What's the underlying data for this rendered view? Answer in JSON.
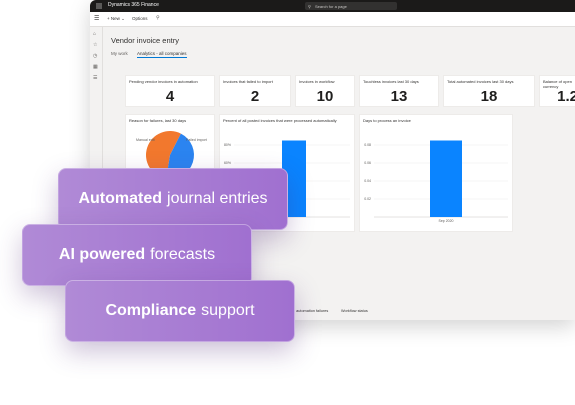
{
  "topbar": {
    "app_name": "Dynamics 365 Finance",
    "search_placeholder": "Search for a page"
  },
  "commands": {
    "new_label": "New",
    "options_label": "Options"
  },
  "page": {
    "title": "Vendor invoice entry",
    "tabs": [
      "My work",
      "Analytics - all companies"
    ]
  },
  "tiles": [
    {
      "label": "Pending vendor invoices in automation",
      "value": "4"
    },
    {
      "label": "Invoices that failed to import",
      "value": "2"
    },
    {
      "label": "Invoices in workflow",
      "value": "10"
    },
    {
      "label": "Touchless invoices last 30 days",
      "value": "13"
    },
    {
      "label": "Total automated invoices last 30 days",
      "value": "18"
    },
    {
      "label": "Balance of open currency",
      "value": "1.2"
    }
  ],
  "panels": [
    {
      "title": "Reason for failures, last 30 days"
    },
    {
      "title": "Percent of all posted invoices that were processed automatically"
    },
    {
      "title": "Days to process an invoice"
    }
  ],
  "bottom_tabs": [
    "n automation failures",
    "Workflow status"
  ],
  "callouts": [
    {
      "bold": "Automated",
      "rest": "journal entries"
    },
    {
      "bold": "AI powered",
      "rest": "forecasts"
    },
    {
      "bold": "Compliance",
      "rest": "support"
    }
  ],
  "chart_data": [
    {
      "type": "pie",
      "labels": [
        "Manual edit",
        "Failed import"
      ],
      "values": [
        55,
        45
      ],
      "colors": [
        "#f2782d",
        "#2b84f0"
      ],
      "title": "Reason for failures, last 30 days"
    },
    {
      "type": "bar",
      "categories": [
        ""
      ],
      "values": [
        85
      ],
      "ylim": [
        0,
        100
      ],
      "y_ticks": [
        "20%",
        "40%",
        "60%",
        "80%"
      ],
      "color": "#0a84ff",
      "title": "Percent of all posted invoices that were processed automatically"
    },
    {
      "type": "bar",
      "categories": [
        "Sep 2020"
      ],
      "values": [
        0.085
      ],
      "ylim": [
        0,
        0.1
      ],
      "y_ticks": [
        "0.02",
        "0.04",
        "0.06",
        "0.08"
      ],
      "color": "#0a84ff",
      "title": "Days to process an invoice"
    }
  ]
}
